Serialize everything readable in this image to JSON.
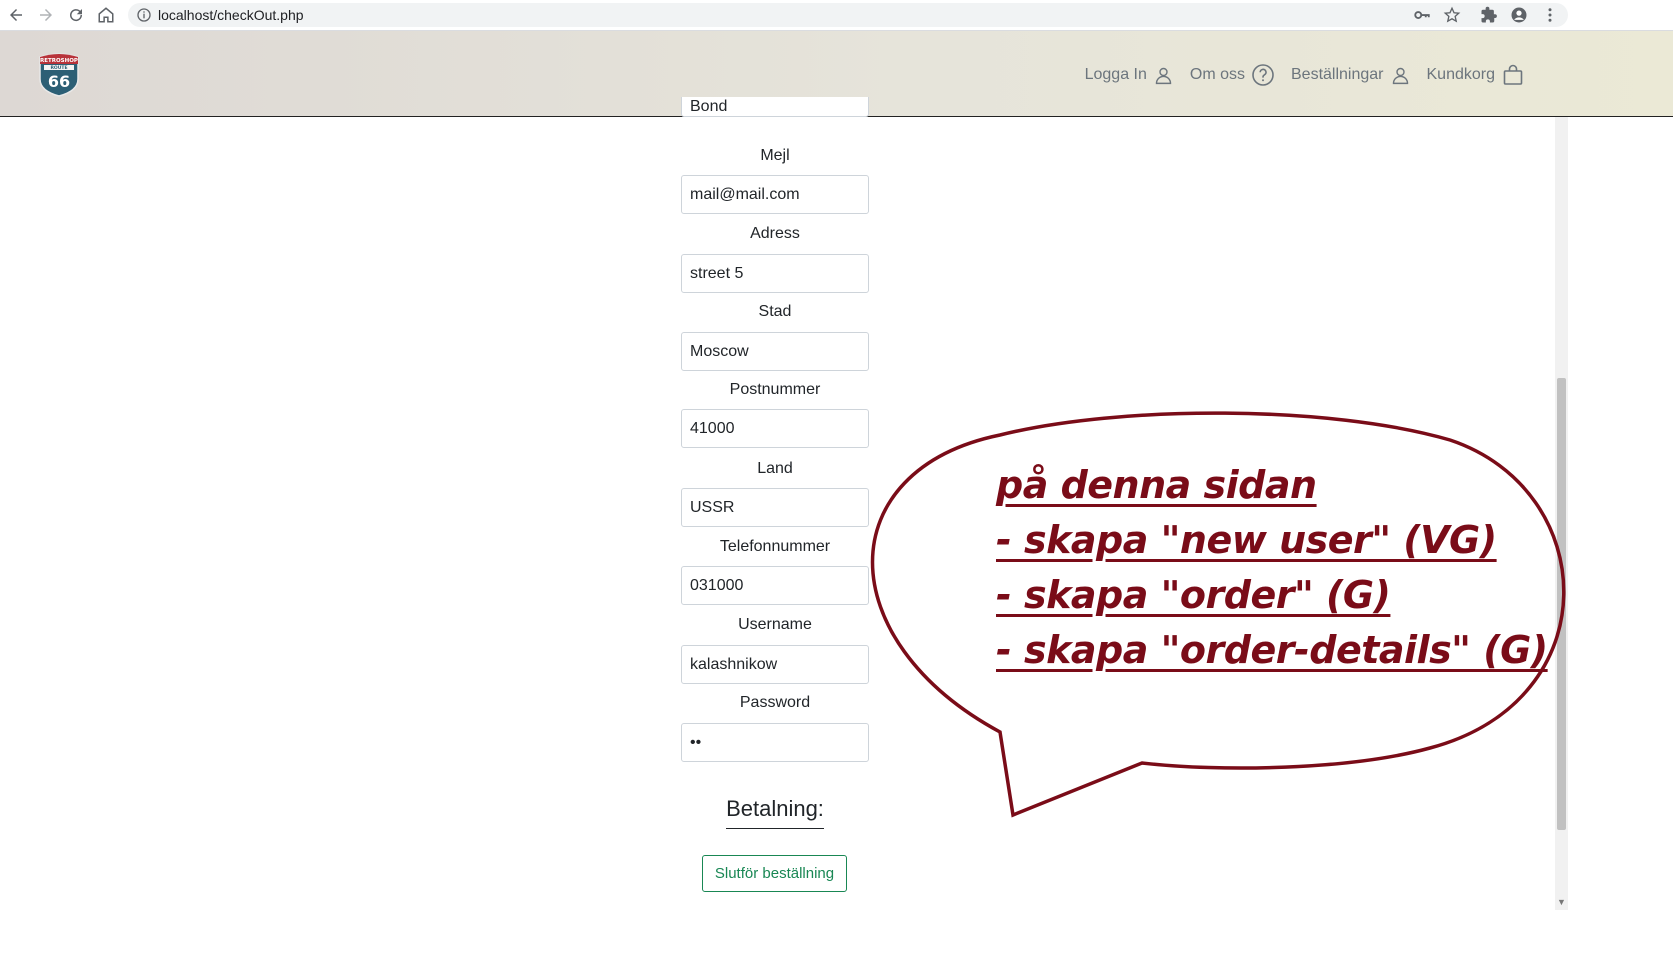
{
  "browser": {
    "url": "localhost/checkOut.php",
    "icons": [
      "back-icon",
      "forward-icon",
      "reload-icon",
      "home-icon",
      "info-icon",
      "key-icon",
      "star-icon",
      "extensions-icon",
      "profile-icon",
      "menu-icon"
    ]
  },
  "header": {
    "logo_alt": "Retroshop Route 66",
    "nav": [
      {
        "label": "Logga In",
        "icon": "user-icon"
      },
      {
        "label": "Om oss",
        "icon": "question-icon"
      },
      {
        "label": "Beställningar",
        "icon": "user-icon"
      },
      {
        "label": "Kundkorg",
        "icon": "bag-icon"
      }
    ]
  },
  "form": {
    "partial_value": "Bond",
    "fields": [
      {
        "label": "Mejl",
        "value": "mail@mail.com"
      },
      {
        "label": "Adress",
        "value": "street 5"
      },
      {
        "label": "Stad",
        "value": "Moscow"
      },
      {
        "label": "Postnummer",
        "value": "41000"
      },
      {
        "label": "Land",
        "value": "USSR"
      },
      {
        "label": "Telefonnummer",
        "value": "031000"
      },
      {
        "label": "Username",
        "value": "kalashnikow"
      },
      {
        "label": "Password",
        "value": "••"
      }
    ],
    "payment_heading": "Betalning:",
    "submit_label": "Slutför beställning"
  },
  "annotation": {
    "color": "#7a0c18",
    "lines": [
      "på denna sidan",
      "- skapa \"new user\" (VG)",
      "- skapa \"order\" (G)",
      "- skapa \"order-details\" (G)"
    ]
  }
}
